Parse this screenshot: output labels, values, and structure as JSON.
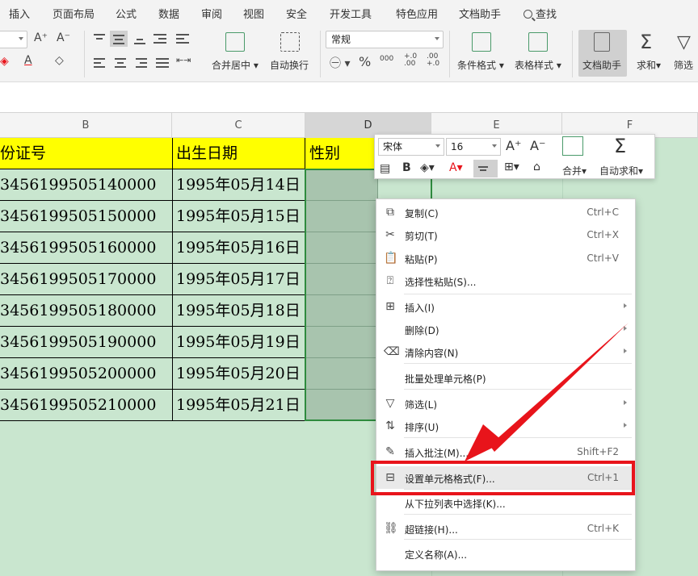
{
  "tabs": [
    "插入",
    "页面布局",
    "公式",
    "数据",
    "审阅",
    "视图",
    "安全",
    "开发工具",
    "特色应用",
    "文档助手",
    "查找"
  ],
  "ribbon": {
    "number_format": "常规",
    "merge_label": "合并居中",
    "wrap_label": "自动换行",
    "percent_symbol": "%",
    "thousands_symbol": "000",
    "inc_decimal": "+.0\n.00",
    "dec_decimal": ".00\n+.0",
    "cond_format": "条件格式",
    "table_style": "表格样式",
    "doc_helper": "文档助手",
    "sum": "求和",
    "filter": "筛选",
    "font_grow": "A⁺",
    "font_shrink": "A⁻",
    "font_color": "A"
  },
  "columns": [
    "B",
    "C",
    "D",
    "E",
    "F"
  ],
  "headers": [
    "份证号",
    "出生日期",
    "性别"
  ],
  "rows": [
    [
      "3456199505140000",
      "1995年05月14日"
    ],
    [
      "3456199505150000",
      "1995年05月15日"
    ],
    [
      "3456199505160000",
      "1995年05月16日"
    ],
    [
      "3456199505170000",
      "1995年05月17日"
    ],
    [
      "3456199505180000",
      "1995年05月18日"
    ],
    [
      "3456199505190000",
      "1995年05月19日"
    ],
    [
      "3456199505200000",
      "1995年05月20日"
    ],
    [
      "3456199505210000",
      "1995年05月21日"
    ]
  ],
  "mini_toolbar": {
    "font": "宋体",
    "size": "16",
    "merge": "合并",
    "autosum": "自动求和"
  },
  "context_menu": [
    {
      "label": "复制(C)",
      "shortcut": "Ctrl+C",
      "icon": "copy-icon"
    },
    {
      "label": "剪切(T)",
      "shortcut": "Ctrl+X",
      "icon": "cut-icon"
    },
    {
      "label": "粘贴(P)",
      "shortcut": "Ctrl+V",
      "icon": "paste-icon"
    },
    {
      "label": "选择性粘贴(S)...",
      "shortcut": "",
      "icon": "paste-special-icon"
    },
    {
      "label": "插入(I)",
      "shortcut": "",
      "icon": "insert-icon"
    },
    {
      "label": "删除(D)",
      "shortcut": "",
      "icon": ""
    },
    {
      "label": "清除内容(N)",
      "shortcut": "",
      "icon": "clear-icon"
    },
    {
      "label": "批量处理单元格(P)",
      "shortcut": "",
      "icon": ""
    },
    {
      "label": "筛选(L)",
      "shortcut": "",
      "icon": "filter-icon"
    },
    {
      "label": "排序(U)",
      "shortcut": "",
      "icon": "sort-icon"
    },
    {
      "label": "插入批注(M)...",
      "shortcut": "Shift+F2",
      "icon": "comment-icon"
    },
    {
      "label": "设置单元格格式(F)...",
      "shortcut": "Ctrl+1",
      "icon": "format-cells-icon"
    },
    {
      "label": "从下拉列表中选择(K)...",
      "shortcut": "",
      "icon": ""
    },
    {
      "label": "超链接(H)...",
      "shortcut": "Ctrl+K",
      "icon": "link-icon"
    },
    {
      "label": "定义名称(A)...",
      "shortcut": "",
      "icon": ""
    }
  ],
  "colors": {
    "header_fill": "#ffff00",
    "sheet_green": "#c9e6cf",
    "selection_green": "#2e8b3e",
    "annotation_red": "#e8141b"
  }
}
